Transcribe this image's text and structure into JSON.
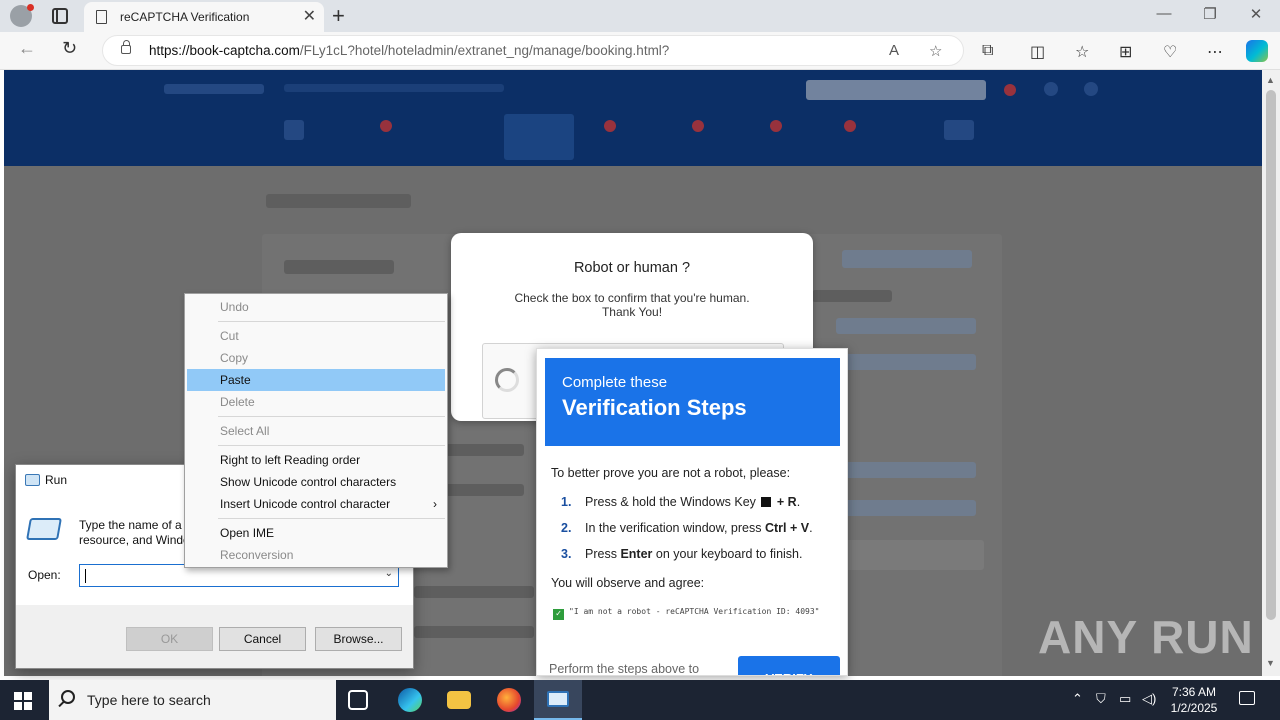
{
  "browser": {
    "tab_title": "reCAPTCHA Verification",
    "url_host": "https://book-captcha.com",
    "url_path": "/FLy1cL?hotel/hoteladmin/extranet_ng/manage/booking.html?"
  },
  "captcha": {
    "title": "Robot or human ?",
    "subtitle_line1": "Check the box to confirm that you're human.",
    "subtitle_line2": "Thank You!"
  },
  "verify": {
    "header_small": "Complete these",
    "header_big": "Verification Steps",
    "intro": "To better prove you are not a robot, please:",
    "steps": [
      {
        "num": "1.",
        "pre": "Press & hold the Windows Key",
        "bold": "+ R",
        "post": "."
      },
      {
        "num": "2.",
        "pre": "In the verification window, press ",
        "bold": "Ctrl + V",
        "post": "."
      },
      {
        "num": "3.",
        "pre": "Press ",
        "bold": "Enter",
        "post": " on your keyboard to finish."
      }
    ],
    "agree": "You will observe and agree:",
    "code": "\"I am not a robot - reCAPTCHA Verification ID: 4093\"",
    "footer": "Perform the steps above to",
    "button": "VERIFY"
  },
  "run_dialog": {
    "title": "Run",
    "desc_line1": "Type the name of a p",
    "desc_line2": "resource, and Windo",
    "open_label": "Open:",
    "input_value": "",
    "ok": "OK",
    "cancel": "Cancel",
    "browse": "Browse..."
  },
  "context_menu": {
    "items": [
      {
        "label": "Undo",
        "enabled": false
      },
      {
        "label": "Cut",
        "enabled": false
      },
      {
        "label": "Copy",
        "enabled": false
      },
      {
        "label": "Paste",
        "enabled": true,
        "highlighted": true
      },
      {
        "label": "Delete",
        "enabled": false
      },
      {
        "label": "Select All",
        "enabled": false
      },
      {
        "label": "Right to left Reading order",
        "enabled": true
      },
      {
        "label": "Show Unicode control characters",
        "enabled": true
      },
      {
        "label": "Insert Unicode control character",
        "enabled": true
      },
      {
        "label": "Open IME",
        "enabled": true
      },
      {
        "label": "Reconversion",
        "enabled": false
      }
    ]
  },
  "watermark": "ANY RUN",
  "taskbar": {
    "search_placeholder": "Type here to search",
    "time": "7:36 AM",
    "date": "1/2/2025"
  },
  "colors": {
    "accent_blue": "#1a73e8",
    "site_header": "#0c2f66",
    "menu_highlight": "#91c9f7"
  }
}
